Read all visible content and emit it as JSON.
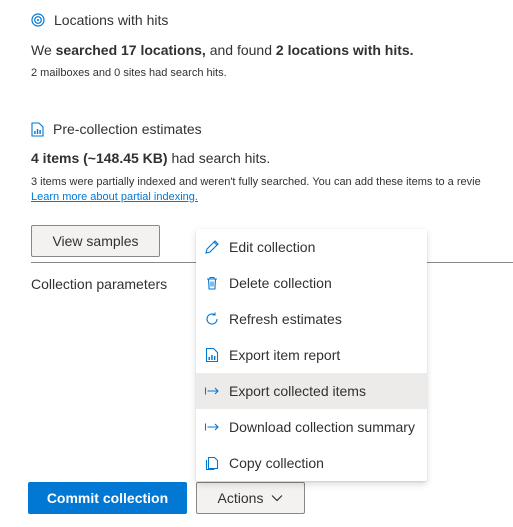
{
  "locations": {
    "heading": "Locations with hits",
    "summary_prefix": "We ",
    "summary_bold1": "searched 17 locations,",
    "summary_mid": " and found ",
    "summary_bold2": "2 locations with hits.",
    "detail": "2 mailboxes and 0 sites had search hits."
  },
  "estimates": {
    "heading": "Pre-collection estimates",
    "items_bold": "4 items (~148.45 KB)",
    "items_rest": " had search hits.",
    "partial_note": "3 items were partially indexed and weren't fully searched. You can add these items to a revie",
    "learn_more_link": "Learn more about partial indexing."
  },
  "buttons": {
    "view_samples": "View samples",
    "commit_collection": "Commit collection",
    "actions": "Actions"
  },
  "collection_parameters_label": "Collection parameters",
  "actions_menu": {
    "items": [
      {
        "label": "Edit collection",
        "icon": "pencil-icon"
      },
      {
        "label": "Delete collection",
        "icon": "trash-icon"
      },
      {
        "label": "Refresh estimates",
        "icon": "refresh-icon"
      },
      {
        "label": "Export item report",
        "icon": "report-icon"
      },
      {
        "label": "Export collected items",
        "icon": "export-arrow-icon"
      },
      {
        "label": "Download collection summary",
        "icon": "export-arrow-icon"
      },
      {
        "label": "Copy collection",
        "icon": "copy-icon"
      }
    ]
  },
  "colors": {
    "accent": "#0078d4",
    "text": "#323130",
    "menu_hover": "#edebe9",
    "button_secondary_bg": "#f3f2f1"
  }
}
